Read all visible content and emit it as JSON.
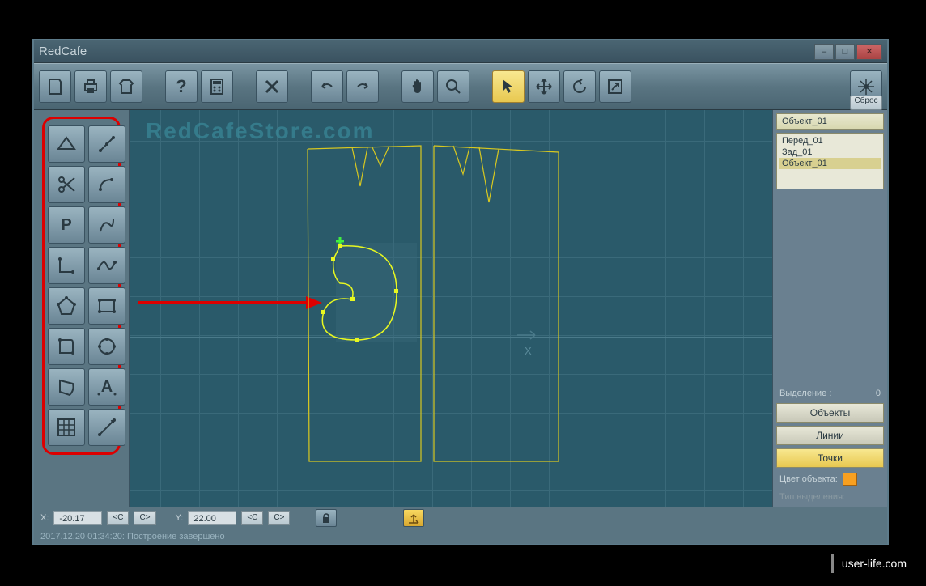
{
  "app": {
    "title": "RedCafe"
  },
  "window_controls": {
    "min": "–",
    "max": "□",
    "close": "✕"
  },
  "toolbar": {
    "reset": "Сброс"
  },
  "canvas": {
    "watermark": "RedCafeStore.com",
    "axis_x": "X"
  },
  "right_panel": {
    "object_label": "Объект_01",
    "list": [
      "Перед_01",
      "Зад_01",
      "Объект_01"
    ],
    "selection_label": "Выделение :",
    "selection_count": "0",
    "btn_objects": "Объекты",
    "btn_lines": "Линии",
    "btn_points": "Точки",
    "color_label": "Цвет объекта:",
    "type_label": "Тип выделения:"
  },
  "status": {
    "x_label": "X:",
    "x_val": "-20.17",
    "y_label": "Y:",
    "y_val": "22.00",
    "btn_lt": "<C",
    "btn_gt": "C>",
    "timestamp": "2017.12.20 01:34:20: Построение завершено"
  },
  "footer": "user-life.com"
}
